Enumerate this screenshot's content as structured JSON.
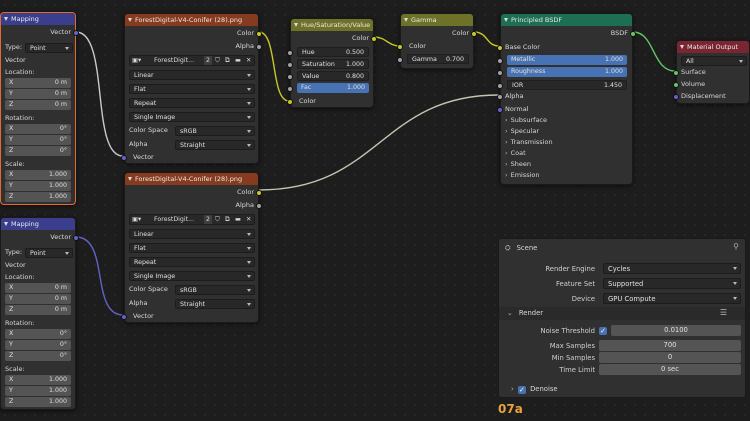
{
  "mapping1": {
    "title": "Mapping",
    "out_vector": "Vector",
    "type_label": "Type:",
    "type_value": "Point",
    "vector_label": "Vector",
    "location_label": "Location:",
    "loc": [
      {
        "axis": "X",
        "value": "0 m"
      },
      {
        "axis": "Y",
        "value": "0 m"
      },
      {
        "axis": "Z",
        "value": "0 m"
      }
    ],
    "rotation_label": "Rotation:",
    "rot": [
      {
        "axis": "X",
        "value": "0°"
      },
      {
        "axis": "Y",
        "value": "0°"
      },
      {
        "axis": "Z",
        "value": "0°"
      }
    ],
    "scale_label": "Scale:",
    "scale": [
      {
        "axis": "X",
        "value": "1.000"
      },
      {
        "axis": "Y",
        "value": "1.000"
      },
      {
        "axis": "Z",
        "value": "1.000"
      }
    ]
  },
  "mapping2": {
    "title": "Mapping",
    "out_vector": "Vector",
    "type_label": "Type:",
    "type_value": "Point",
    "vector_label": "Vector",
    "location_label": "Location:",
    "loc": [
      {
        "axis": "X",
        "value": "0 m"
      },
      {
        "axis": "Y",
        "value": "0 m"
      },
      {
        "axis": "Z",
        "value": "0 m"
      }
    ],
    "rotation_label": "Rotation:",
    "rot": [
      {
        "axis": "X",
        "value": "0°"
      },
      {
        "axis": "Y",
        "value": "0°"
      },
      {
        "axis": "Z",
        "value": "0°"
      }
    ],
    "scale_label": "Scale:",
    "scale": [
      {
        "axis": "X",
        "value": "1.000"
      },
      {
        "axis": "Y",
        "value": "1.000"
      },
      {
        "axis": "Z",
        "value": "1.000"
      }
    ]
  },
  "image1": {
    "title": "ForestDigital-V4-Conifer (28).png",
    "out_color": "Color",
    "out_alpha": "Alpha",
    "image_name": "ForestDigit...",
    "users": "2",
    "interpolation": "Linear",
    "projection": "Flat",
    "extension": "Repeat",
    "source": "Single Image",
    "colorspace_label": "Color Space",
    "colorspace_value": "sRGB",
    "alpha_label": "Alpha",
    "alpha_value": "Straight",
    "in_vector": "Vector"
  },
  "image2": {
    "title": "ForestDigital-V4-Conifer (28).png",
    "out_color": "Color",
    "out_alpha": "Alpha",
    "image_name": "ForestDigit...",
    "users": "2",
    "interpolation": "Linear",
    "projection": "Flat",
    "extension": "Repeat",
    "source": "Single Image",
    "colorspace_label": "Color Space",
    "colorspace_value": "sRGB",
    "alpha_label": "Alpha",
    "alpha_value": "Straight",
    "in_vector": "Vector"
  },
  "hsv": {
    "title": "Hue/Saturation/Value",
    "out_color": "Color",
    "fields": [
      {
        "label": "Hue",
        "value": "0.500"
      },
      {
        "label": "Saturation",
        "value": "1.000"
      },
      {
        "label": "Value",
        "value": "0.800"
      },
      {
        "label": "Fac",
        "value": "1.000"
      }
    ],
    "in_color": "Color"
  },
  "gamma": {
    "title": "Gamma",
    "out_color": "Color",
    "in_color": "Color",
    "gamma_label": "Gamma",
    "gamma_value": "0.700"
  },
  "bsdf": {
    "title": "Principled BSDF",
    "out_bsdf": "BSDF",
    "base_color": "Base Color",
    "fields": [
      {
        "label": "Metallic",
        "value": "1.000"
      },
      {
        "label": "Roughness",
        "value": "1.000"
      },
      {
        "label": "IOR",
        "value": "1.450"
      }
    ],
    "alpha": "Alpha",
    "normal": "Normal",
    "panels": [
      "Subsurface",
      "Specular",
      "Transmission",
      "Coat",
      "Sheen",
      "Emission"
    ]
  },
  "output": {
    "title": "Material Output",
    "target": "All",
    "surface": "Surface",
    "volume": "Volume",
    "displacement": "Displacement"
  },
  "properties": {
    "scene_label": "Scene",
    "render_engine_label": "Render Engine",
    "render_engine_value": "Cycles",
    "feature_set_label": "Feature Set",
    "feature_set_value": "Supported",
    "device_label": "Device",
    "device_value": "GPU Compute",
    "render_panel": "Render",
    "noise_threshold_label": "Noise Threshold",
    "noise_threshold_value": "0.0100",
    "max_samples_label": "Max Samples",
    "max_samples_value": "700",
    "min_samples_label": "Min Samples",
    "min_samples_value": "0",
    "time_limit_label": "Time Limit",
    "time_limit_value": "0 sec",
    "denoise_label": "Denoise"
  },
  "overlay_label": "07a",
  "colors": {
    "wire_vector": "#6363c7",
    "wire_color": "#c7c729",
    "wire_shader": "#63c763",
    "selected": "#e06b2e",
    "accent_blue": "#4772b3"
  }
}
